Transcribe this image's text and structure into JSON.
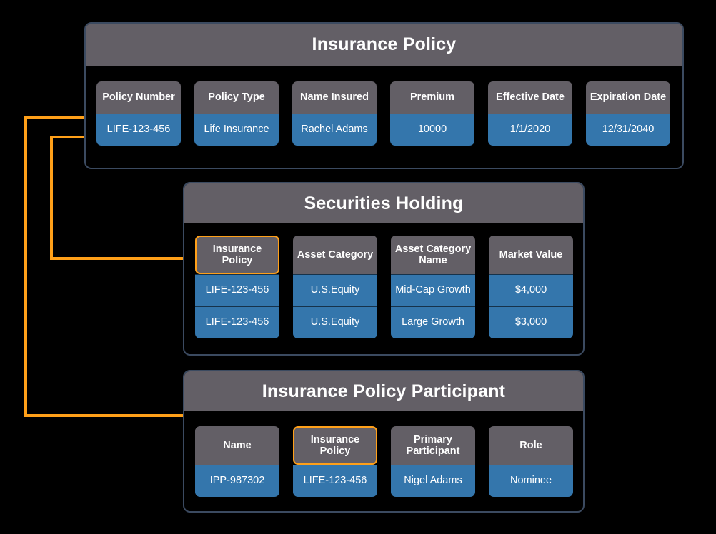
{
  "colors": {
    "header_gray": "#635f66",
    "cell_blue": "#3476ac",
    "panel_border": "#3b4a60",
    "highlight_orange": "#ffa019",
    "background": "#000000",
    "text": "#ffffff"
  },
  "panels": [
    {
      "id": "insurance-policy",
      "title": "Insurance Policy",
      "columns": [
        {
          "header": "Policy Number",
          "highlight": false,
          "values": [
            "LIFE-123-456"
          ]
        },
        {
          "header": "Policy Type",
          "highlight": false,
          "values": [
            "Life Insurance"
          ]
        },
        {
          "header": "Name Insured",
          "highlight": false,
          "values": [
            "Rachel Adams"
          ]
        },
        {
          "header": "Premium",
          "highlight": false,
          "values": [
            "10000"
          ]
        },
        {
          "header": "Effective Date",
          "highlight": false,
          "values": [
            "1/1/2020"
          ]
        },
        {
          "header": "Expiration Date",
          "highlight": false,
          "values": [
            "12/31/2040"
          ]
        }
      ]
    },
    {
      "id": "securities-holding",
      "title": "Securities Holding",
      "columns": [
        {
          "header": "Insurance Policy",
          "highlight": true,
          "values": [
            "LIFE-123-456",
            "LIFE-123-456"
          ]
        },
        {
          "header": "Asset Category",
          "highlight": false,
          "values": [
            "U.S.Equity",
            "U.S.Equity"
          ]
        },
        {
          "header": "Asset Category Name",
          "highlight": false,
          "values": [
            "Mid-Cap Growth",
            "Large Growth"
          ]
        },
        {
          "header": "Market Value",
          "highlight": false,
          "values": [
            "$4,000",
            "$3,000"
          ]
        }
      ]
    },
    {
      "id": "insurance-policy-participant",
      "title": "Insurance Policy Participant",
      "columns": [
        {
          "header": "Name",
          "highlight": false,
          "values": [
            "IPP-987302"
          ]
        },
        {
          "header": "Insurance Policy",
          "highlight": true,
          "values": [
            "LIFE-123-456"
          ]
        },
        {
          "header": "Primary Participant",
          "highlight": false,
          "values": [
            "Nigel Adams"
          ]
        },
        {
          "header": "Role",
          "highlight": false,
          "values": [
            "Nominee"
          ]
        }
      ]
    }
  ],
  "connectors": [
    {
      "name": "policy-to-participant",
      "from": "Policy Number",
      "to": "Insurance Policy Participant / Insurance Policy"
    },
    {
      "name": "policy-to-holding",
      "from": "Policy Number",
      "to": "Securities Holding / Insurance Policy"
    }
  ]
}
